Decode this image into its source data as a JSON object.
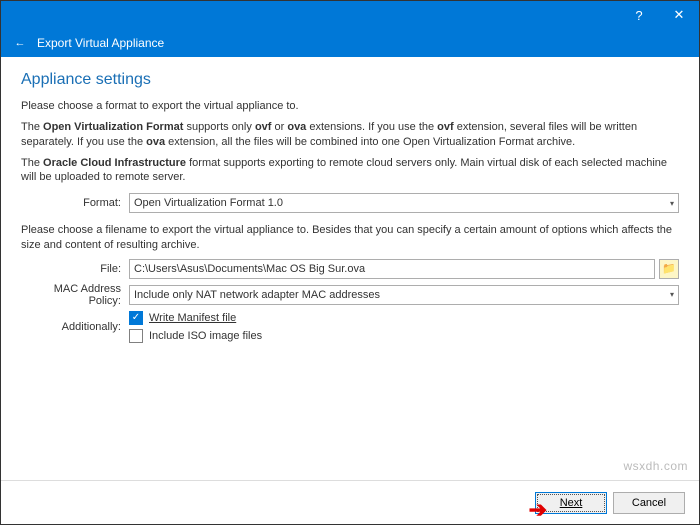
{
  "titlebar": {
    "help": "?",
    "close": "✕"
  },
  "nav": {
    "back": "←",
    "title": "Export Virtual Appliance"
  },
  "section_title": "Appliance settings",
  "p1": "Please choose a format to export the virtual appliance to.",
  "p2_a": "The ",
  "p2_b": "Open Virtualization Format",
  "p2_c": " supports only ",
  "p2_d": "ovf",
  "p2_e": " or ",
  "p2_f": "ova",
  "p2_g": " extensions. If you use the ",
  "p2_h": "ovf",
  "p2_i": " extension, several files will be written separately. If you use the ",
  "p2_j": "ova",
  "p2_k": " extension, all the files will be combined into one Open Virtualization Format archive.",
  "p3_a": "The ",
  "p3_b": "Oracle Cloud Infrastructure",
  "p3_c": " format supports exporting to remote cloud servers only. Main virtual disk of each selected machine will be uploaded to remote server.",
  "labels": {
    "format": "Format:",
    "file": "File:",
    "mac": "MAC Address Policy:",
    "additionally": "Additionally:"
  },
  "fields": {
    "format_value": "Open Virtualization Format 1.0",
    "file_value": "C:\\Users\\Asus\\Documents\\Mac OS Big Sur.ova",
    "mac_value": "Include only NAT network adapter MAC addresses",
    "write_manifest": "Write Manifest file",
    "include_iso": "Include ISO image files"
  },
  "p4": "Please choose a filename to export the virtual appliance to. Besides that you can specify a certain amount of options which affects the size and content of resulting archive.",
  "buttons": {
    "next": "Next",
    "cancel": "Cancel"
  },
  "watermark": "wsxdh.com",
  "folder_glyph": "📁",
  "check_glyph": "✓"
}
